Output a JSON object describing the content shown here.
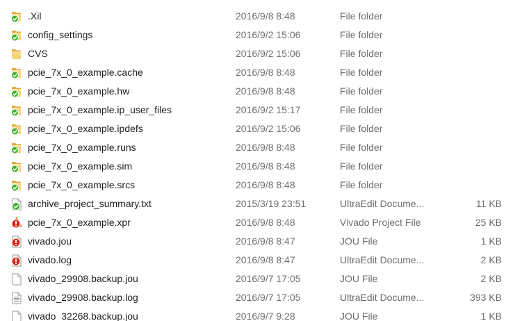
{
  "files": [
    {
      "name": ".Xil",
      "date": "2016/9/8 8:48",
      "type": "File folder",
      "size": "",
      "icon": "folder-synced-icon"
    },
    {
      "name": "config_settings",
      "date": "2016/9/2 15:06",
      "type": "File folder",
      "size": "",
      "icon": "folder-synced-icon"
    },
    {
      "name": "CVS",
      "date": "2016/9/2 15:06",
      "type": "File folder",
      "size": "",
      "icon": "folder-icon"
    },
    {
      "name": "pcie_7x_0_example.cache",
      "date": "2016/9/8 8:48",
      "type": "File folder",
      "size": "",
      "icon": "folder-synced-icon"
    },
    {
      "name": "pcie_7x_0_example.hw",
      "date": "2016/9/8 8:48",
      "type": "File folder",
      "size": "",
      "icon": "folder-synced-icon"
    },
    {
      "name": "pcie_7x_0_example.ip_user_files",
      "date": "2016/9/2 15:17",
      "type": "File folder",
      "size": "",
      "icon": "folder-synced-icon"
    },
    {
      "name": "pcie_7x_0_example.ipdefs",
      "date": "2016/9/2 15:06",
      "type": "File folder",
      "size": "",
      "icon": "folder-synced-icon"
    },
    {
      "name": "pcie_7x_0_example.runs",
      "date": "2016/9/8 8:48",
      "type": "File folder",
      "size": "",
      "icon": "folder-synced-icon"
    },
    {
      "name": "pcie_7x_0_example.sim",
      "date": "2016/9/8 8:48",
      "type": "File folder",
      "size": "",
      "icon": "folder-synced-icon"
    },
    {
      "name": "pcie_7x_0_example.srcs",
      "date": "2016/9/8 8:48",
      "type": "File folder",
      "size": "",
      "icon": "folder-synced-icon"
    },
    {
      "name": "archive_project_summary.txt",
      "date": "2015/3/19 23:51",
      "type": "UltraEdit Docume...",
      "size": "11 KB",
      "icon": "file-synced-icon"
    },
    {
      "name": "pcie_7x_0_example.xpr",
      "date": "2016/9/8 8:48",
      "type": "Vivado Project File",
      "size": "25 KB",
      "icon": "vivado-modified-icon"
    },
    {
      "name": "vivado.jou",
      "date": "2016/9/8 8:47",
      "type": "JOU File",
      "size": "1 KB",
      "icon": "file-modified-icon"
    },
    {
      "name": "vivado.log",
      "date": "2016/9/8 8:47",
      "type": "UltraEdit Docume...",
      "size": "2 KB",
      "icon": "file-modified-icon"
    },
    {
      "name": "vivado_29908.backup.jou",
      "date": "2016/9/7 17:05",
      "type": "JOU File",
      "size": "2 KB",
      "icon": "file-icon"
    },
    {
      "name": "vivado_29908.backup.log",
      "date": "2016/9/7 17:05",
      "type": "UltraEdit Docume...",
      "size": "393 KB",
      "icon": "text-file-icon"
    },
    {
      "name": "vivado_32268.backup.jou",
      "date": "2016/9/7 9:28",
      "type": "JOU File",
      "size": "1 KB",
      "icon": "file-icon"
    }
  ],
  "colors": {
    "folder": "#f2c55c",
    "folder_dark": "#dfa93a",
    "synced_badge": "#3fae2a",
    "modified_badge": "#d62a1e"
  }
}
